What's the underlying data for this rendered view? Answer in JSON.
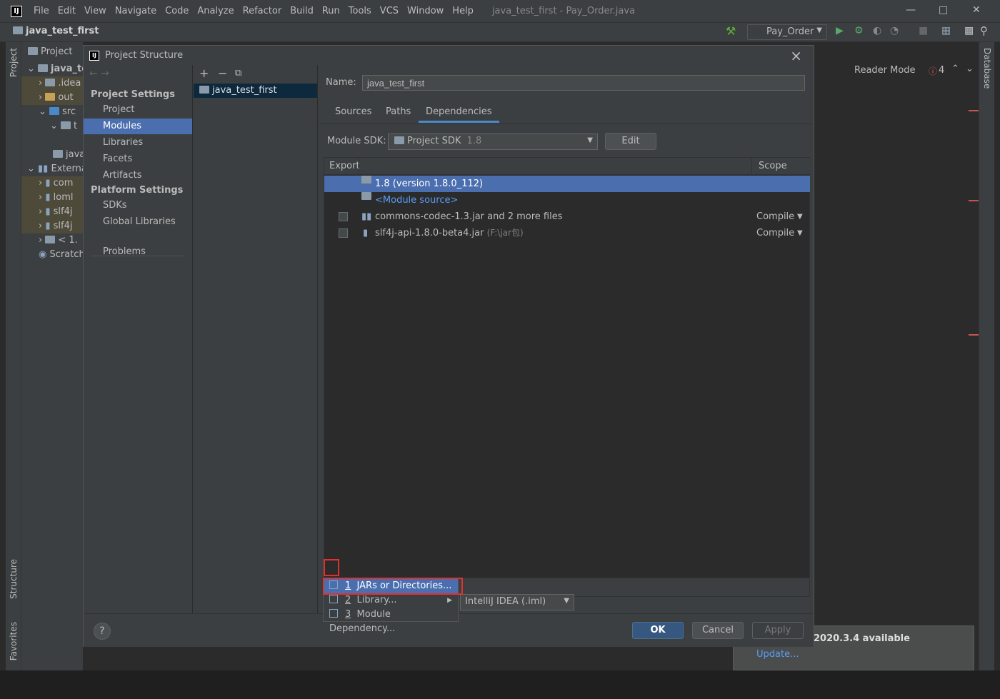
{
  "menubar": {
    "items": [
      "File",
      "Edit",
      "View",
      "Navigate",
      "Code",
      "Analyze",
      "Refactor",
      "Build",
      "Run",
      "Tools",
      "VCS",
      "Window",
      "Help"
    ],
    "window_title": "java_test_first - Pay_Order.java"
  },
  "navbar": {
    "project": "java_test_first",
    "run_config": "Pay_Order"
  },
  "left_strip": {
    "project_tab": "Project",
    "structure_tab": "Structure",
    "favorites_tab": "Favorites"
  },
  "right_strip": {
    "database_tab": "Database"
  },
  "project_panel": {
    "header": "Project",
    "rows": [
      "java_te",
      ".idea",
      "out",
      "src",
      "t",
      "java",
      "Externa",
      "com",
      "loml",
      "slf4j",
      "slf4j",
      "< 1.",
      "Scratch"
    ]
  },
  "editor": {
    "reader_mode": "Reader Mode",
    "error_count": "4"
  },
  "notification": {
    "text": "2020.3.4 available",
    "link": "Update..."
  },
  "dialog": {
    "title": "Project Structure",
    "nav": {
      "project_settings": "Project Settings",
      "project_items": [
        "Project",
        "Modules",
        "Libraries",
        "Facets",
        "Artifacts"
      ],
      "platform_settings": "Platform Settings",
      "platform_items": [
        "SDKs",
        "Global Libraries"
      ],
      "problems": "Problems"
    },
    "modules": [
      "java_test_first"
    ],
    "detail": {
      "name_label": "Name:",
      "name_value": "java_test_first",
      "tabs": [
        "Sources",
        "Paths",
        "Dependencies"
      ],
      "sdk_label": "Module SDK:",
      "sdk_value": "Project SDK",
      "sdk_version": "1.8",
      "edit_button": "Edit",
      "table": {
        "col_export": "Export",
        "col_scope": "Scope",
        "rows": [
          {
            "name": "1.8 (version 1.8.0_112)",
            "scope": "",
            "extra": ""
          },
          {
            "name": "<Module source>",
            "scope": "",
            "extra": ""
          },
          {
            "name": "commons-codec-1.3.jar and 2 more files",
            "scope": "Compile",
            "extra": ""
          },
          {
            "name": "slf4j-api-1.8.0-beta4.jar",
            "scope": "Compile",
            "extra": "(F:\\jar包)"
          }
        ]
      },
      "format_value": "IntelliJ IDEA (.iml)"
    },
    "popup": [
      {
        "num": "1",
        "label": "JARs or Directories..."
      },
      {
        "num": "2",
        "label": "Library..."
      },
      {
        "num": "3",
        "label": "Module Dependency..."
      }
    ],
    "buttons": {
      "help": "?",
      "ok": "OK",
      "cancel": "Cancel",
      "apply": "Apply"
    }
  },
  "colors": {
    "accent": "#4b6eaf",
    "highlight_box": "#e03030",
    "link": "#589df6"
  }
}
